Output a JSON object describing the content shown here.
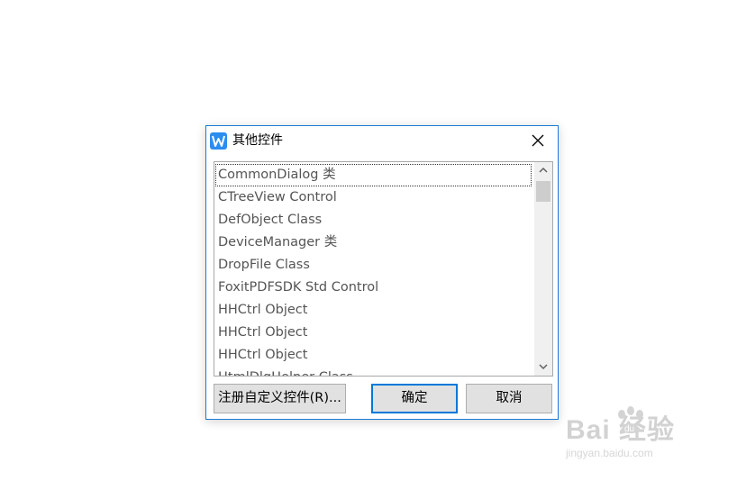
{
  "dialog": {
    "title": "其他控件",
    "app_icon": "wps-writer-icon",
    "close_icon": "close-icon"
  },
  "list": {
    "items": [
      "CommonDialog 类",
      "CTreeView Control",
      "DefObject Class",
      "DeviceManager 类",
      "DropFile Class",
      "FoxitPDFSDK Std Control",
      "HHCtrl Object",
      "HHCtrl Object",
      "HHCtrl Object",
      "HtmlDlgHelper Class"
    ],
    "focused_index": 0
  },
  "buttons": {
    "register": "注册自定义控件(R)...",
    "ok": "确定",
    "cancel": "取消"
  },
  "watermark": {
    "main": "Bai  经验",
    "sub": "jingyan.baidu.com"
  },
  "colors": {
    "accent": "#0078d7",
    "title_border": "#1a7ad6",
    "item_text": "#555555"
  }
}
